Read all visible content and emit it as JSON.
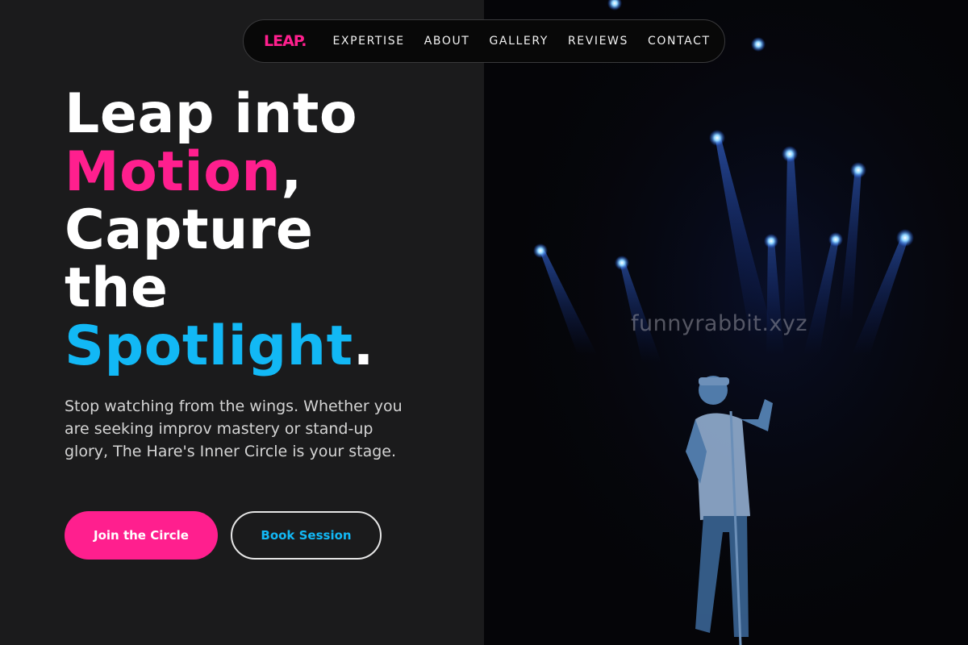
{
  "nav": {
    "logo": "LEAP.",
    "links": [
      "EXPERTISE",
      "ABOUT",
      "GALLERY",
      "REVIEWS",
      "CONTACT"
    ]
  },
  "hero": {
    "line1": "Leap into",
    "line2_highlight": "Motion",
    "line2_suffix": ",",
    "line3": "Capture",
    "line4": "the",
    "line5_highlight": "Spotlight",
    "line5_suffix": ".",
    "description": "Stop watching from the wings. Whether you are seeking improv mastery or stand-up glory, The Hare's Inner Circle is your stage.",
    "primary_button": "Join the Circle",
    "secondary_button": "Book Session"
  },
  "watermark": "funnyrabbit.xyz",
  "colors": {
    "accent_pink": "#ff1f8e",
    "accent_blue": "#12b8f5",
    "background": "#1b1b1c"
  }
}
